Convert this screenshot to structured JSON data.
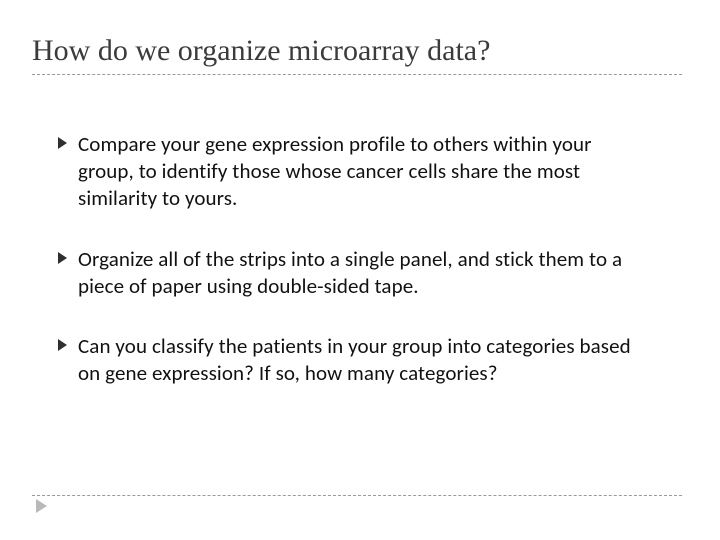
{
  "slide": {
    "title": "How do we organize microarray data?",
    "bullets": [
      "Compare your gene expression profile to others within your group, to identify those whose cancer cells share the most similarity to yours.",
      "Organize all of the strips into a single panel, and stick them to a piece of paper using double-sided tape.",
      "Can you classify the patients in your group into categories based on gene expression? If so, how many categories?"
    ]
  }
}
